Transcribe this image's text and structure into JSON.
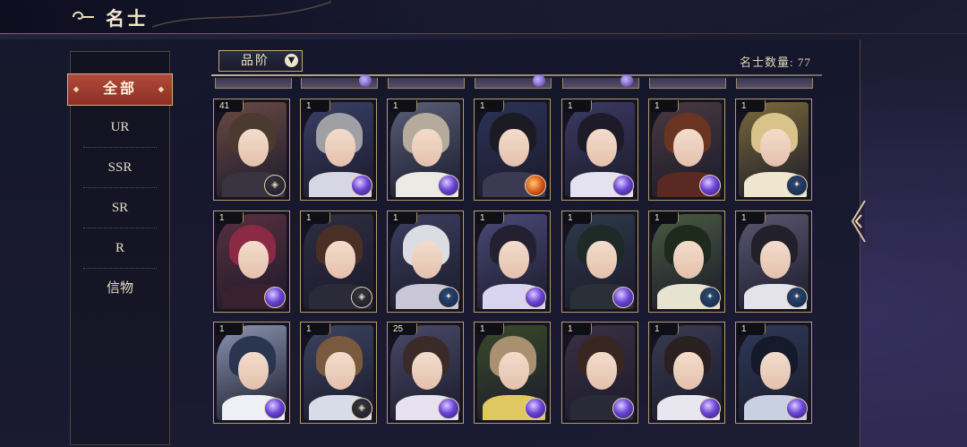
{
  "header": {
    "title": "名士",
    "back_icon": "swirl-back-icon"
  },
  "sidebar": {
    "items": [
      {
        "label": "全部",
        "active": true
      },
      {
        "label": "UR",
        "active": false
      },
      {
        "label": "SSR",
        "active": false
      },
      {
        "label": "SR",
        "active": false
      },
      {
        "label": "R",
        "active": false
      },
      {
        "label": "信物",
        "active": false
      }
    ]
  },
  "filter": {
    "label": "品阶",
    "icon": "chevron-down-icon"
  },
  "count": {
    "label": "名士数量:",
    "value": "77"
  },
  "colors": {
    "accent": "#9c3a2e",
    "gold": "#c8a978",
    "panel": "#171729"
  },
  "cards": [
    {
      "level": "41",
      "badge": "dark",
      "hair": "#4a3a30",
      "bg": "#6b4a44",
      "cloth": "#3a3440"
    },
    {
      "level": "1",
      "badge": "purple",
      "hair": "#9fa0a4",
      "bg": "#3a4066",
      "cloth": "#d7d7e4"
    },
    {
      "level": "1",
      "badge": "purple",
      "hair": "#b4ab9c",
      "bg": "#5a5f78",
      "cloth": "#eceae4"
    },
    {
      "level": "1",
      "badge": "fire",
      "hair": "#1c1a22",
      "bg": "#2c3358",
      "cloth": "#3c3a52"
    },
    {
      "level": "1",
      "badge": "purple",
      "hair": "#1e1a2a",
      "bg": "#3c3a63",
      "cloth": "#e4e2f0"
    },
    {
      "level": "1",
      "badge": "purple",
      "hair": "#6a3520",
      "bg": "#4a3a40",
      "cloth": "#5a2a22"
    },
    {
      "level": "1",
      "badge": "blue",
      "hair": "#d8c48a",
      "bg": "#7a6a3a",
      "cloth": "#efe6cf"
    },
    {
      "level": "1",
      "badge": "purple",
      "hair": "#8a2a45",
      "bg": "#5a3040",
      "cloth": "#3a2030"
    },
    {
      "level": "1",
      "badge": "dark",
      "hair": "#4a2f26",
      "bg": "#2e2e42",
      "cloth": "#2a2a38"
    },
    {
      "level": "1",
      "badge": "blue",
      "hair": "#dcdde2",
      "bg": "#3c3f60",
      "cloth": "#c9c6d8"
    },
    {
      "level": "1",
      "badge": "purple",
      "hair": "#242032",
      "bg": "#4a4a78",
      "cloth": "#d9d4f0"
    },
    {
      "level": "1",
      "badge": "purple",
      "hair": "#1e2a28",
      "bg": "#2e3a4a",
      "cloth": "#2a3038"
    },
    {
      "level": "1",
      "badge": "blue",
      "hair": "#1e2a1e",
      "bg": "#4a5a40",
      "cloth": "#e8e2d0"
    },
    {
      "level": "1",
      "badge": "blue",
      "hair": "#22202a",
      "bg": "#5a5870",
      "cloth": "#e4e2ea"
    },
    {
      "level": "1",
      "badge": "purple",
      "hair": "#2a3550",
      "bg": "#8a94b0",
      "cloth": "#eef0f6"
    },
    {
      "level": "1",
      "badge": "dark",
      "hair": "#7a5a3e",
      "bg": "#3a4460",
      "cloth": "#d8dce8"
    },
    {
      "level": "25",
      "badge": "purple",
      "hair": "#3a2a28",
      "bg": "#4a4a6a",
      "cloth": "#e6e2ef"
    },
    {
      "level": "1",
      "badge": "purple",
      "hair": "#a89070",
      "bg": "#3a4a2a",
      "cloth": "#e0c860"
    },
    {
      "level": "1",
      "badge": "purple",
      "hair": "#3a2620",
      "bg": "#3a3044",
      "cloth": "#2a2a36"
    },
    {
      "level": "1",
      "badge": "purple",
      "hair": "#2a2022",
      "bg": "#3a3a52",
      "cloth": "#e8e6ee"
    },
    {
      "level": "1",
      "badge": "purple",
      "hair": "#141a2a",
      "bg": "#2e3a58",
      "cloth": "#c8d0e2"
    }
  ]
}
